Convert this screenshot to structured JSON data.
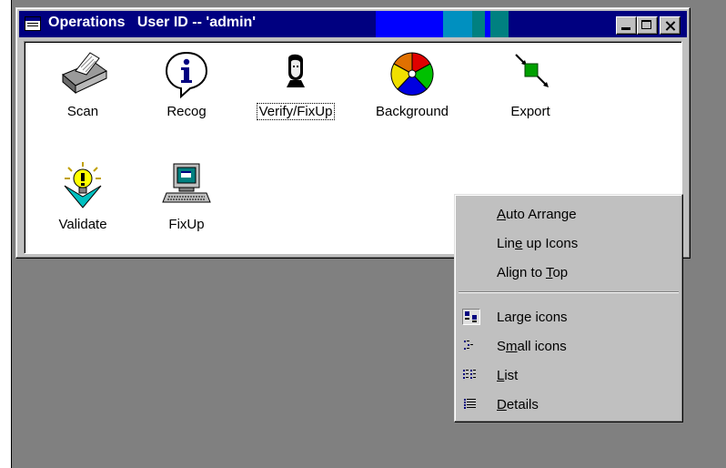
{
  "window": {
    "title": "Operations",
    "user_label": "User ID -- 'admin'"
  },
  "icons": [
    {
      "label": "Scan",
      "icon": "scanner-icon"
    },
    {
      "label": "Recog",
      "icon": "info-bubble-icon"
    },
    {
      "label": "Verify/FixUp",
      "icon": "person-head-icon"
    },
    {
      "label": "Background",
      "icon": "color-wheel-icon"
    },
    {
      "label": "Export",
      "icon": "export-arrows-icon"
    },
    {
      "label": "Validate",
      "icon": "lightbulb-icon"
    },
    {
      "label": "FixUp",
      "icon": "computer-icon"
    }
  ],
  "context_menu": {
    "items": [
      {
        "pre": "",
        "u": "A",
        "post": "uto Arrange"
      },
      {
        "pre": "Lin",
        "u": "e",
        "post": " up Icons"
      },
      {
        "pre": "Align to ",
        "u": "T",
        "post": "op"
      },
      {
        "pre": "",
        "u": "",
        "post": "Large icons",
        "icon": "large-icons-icon",
        "checked": true
      },
      {
        "pre": "S",
        "u": "m",
        "post": "all icons",
        "icon": "small-icons-icon"
      },
      {
        "pre": "",
        "u": "L",
        "post": "ist",
        "icon": "list-view-icon"
      },
      {
        "pre": "",
        "u": "D",
        "post": "etails",
        "icon": "details-view-icon"
      }
    ]
  },
  "colors": {
    "titlebar": "#000080",
    "desktop": "#808080",
    "face": "#c0c0c0"
  }
}
